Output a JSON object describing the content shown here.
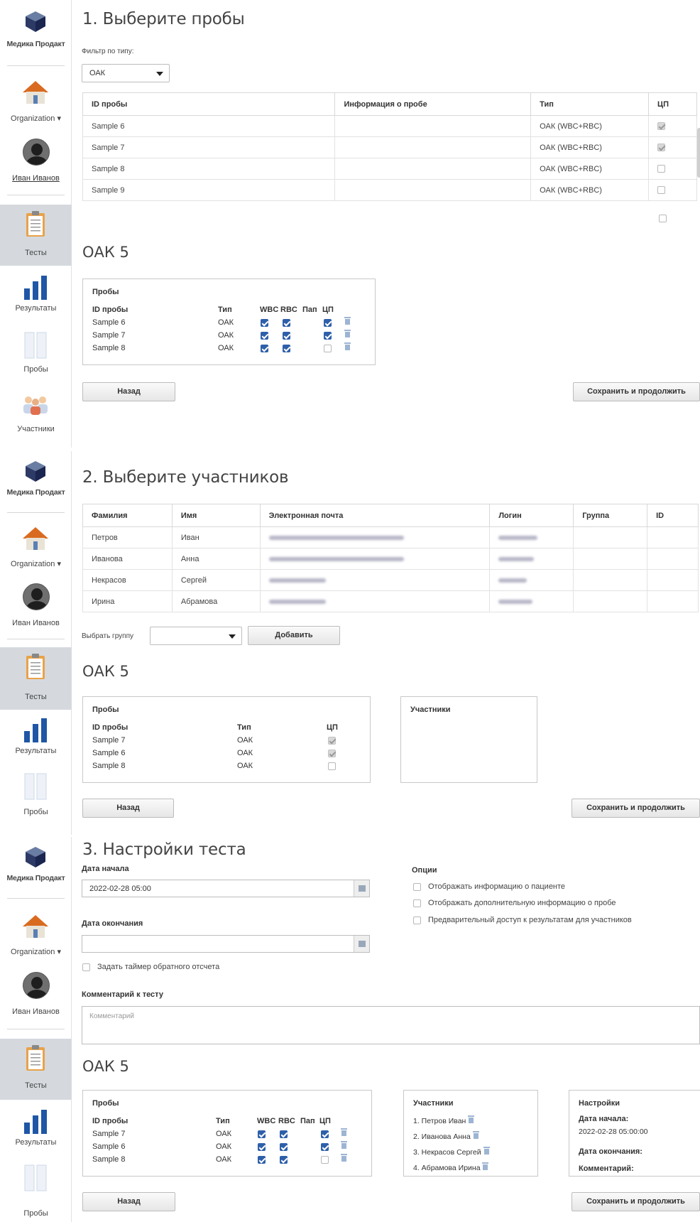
{
  "sidebar": {
    "brand": "Медика Продакт",
    "organization": "Organization",
    "user": "Иван Иванов",
    "items": {
      "tests": "Тесты",
      "results": "Результаты",
      "samples": "Пробы",
      "participants": "Участники"
    }
  },
  "step1": {
    "title": "1. Выберите пробы",
    "filter_label": "Фильтр по типу:",
    "filter_value": "ОАК",
    "columns": [
      "ID пробы",
      "Информация о пробе",
      "Тип",
      "ЦП"
    ],
    "rows": [
      {
        "id": "Sample 6",
        "info": "",
        "type": "ОАК (WBC+RBC)",
        "cp": true
      },
      {
        "id": "Sample 7",
        "info": "",
        "type": "ОАК (WBC+RBC)",
        "cp": true
      },
      {
        "id": "Sample 8",
        "info": "",
        "type": "ОАК (WBC+RBC)",
        "cp": false
      },
      {
        "id": "Sample 9",
        "info": "",
        "type": "ОАК (WBC+RBC)",
        "cp": false
      }
    ],
    "test_name": "ОАК 5",
    "box_title": "Пробы",
    "mini_columns": [
      "ID пробы",
      "Тип",
      "WBC",
      "RBC",
      "Пап",
      "ЦП"
    ],
    "mini_rows": [
      {
        "id": "Sample 6",
        "type": "ОАК",
        "wbc": true,
        "rbc": true,
        "cp": true
      },
      {
        "id": "Sample 7",
        "type": "ОАК",
        "wbc": true,
        "rbc": true,
        "cp": true
      },
      {
        "id": "Sample 8",
        "type": "ОАК",
        "wbc": true,
        "rbc": true,
        "cp": false
      }
    ],
    "back": "Назад",
    "save": "Сохранить и продолжить"
  },
  "step2": {
    "title": "2. Выберите участников",
    "columns": [
      "Фамилия",
      "Имя",
      "Электронная почта",
      "Логин",
      "Группа",
      "ID"
    ],
    "rows": [
      {
        "last": "Петров",
        "first": "Иван"
      },
      {
        "last": "Иванова",
        "first": "Анна"
      },
      {
        "last": "Некрасов",
        "first": "Сергей"
      },
      {
        "last": "Ирина",
        "first": "Абрамова"
      }
    ],
    "group_label": "Выбрать группу",
    "add": "Добавить",
    "test_name": "ОАК 5",
    "box_title": "Пробы",
    "mini_columns": [
      "ID пробы",
      "Тип",
      "ЦП"
    ],
    "mini_rows": [
      {
        "id": "Sample 7",
        "type": "ОАК",
        "cp": true
      },
      {
        "id": "Sample 6",
        "type": "ОАК",
        "cp": true
      },
      {
        "id": "Sample 8",
        "type": "ОАК",
        "cp": false
      }
    ],
    "participants_title": "Участники",
    "back": "Назад",
    "save": "Сохранить и продолжить"
  },
  "step3": {
    "title": "3. Настройки теста",
    "start_label": "Дата начала",
    "start_value": "2022-02-28 05:00",
    "end_label": "Дата окончания",
    "timer": "Задать таймер обратного отсчета",
    "options_title": "Опции",
    "options": [
      "Отображать информацию о пациенте",
      "Отображать дополнительную информацию о пробе",
      "Предварительный доступ к результатам для участников"
    ],
    "comment_label": "Комментарий к тесту",
    "comment_placeholder": "Комментарий",
    "test_name": "ОАК 5",
    "box_title": "Пробы",
    "mini_columns": [
      "ID пробы",
      "Тип",
      "WBC",
      "RBC",
      "Пап",
      "ЦП"
    ],
    "mini_rows": [
      {
        "id": "Sample 7",
        "type": "ОАК",
        "wbc": true,
        "rbc": true,
        "cp": true
      },
      {
        "id": "Sample 6",
        "type": "ОАК",
        "wbc": true,
        "rbc": true,
        "cp": true
      },
      {
        "id": "Sample 8",
        "type": "ОАК",
        "wbc": true,
        "rbc": true,
        "cp": false
      }
    ],
    "participants_title": "Участники",
    "participants": [
      "1. Петров Иван",
      "2. Иванова Анна",
      "3. Некрасов Сергей",
      "4. Абрамова Ирина"
    ],
    "settings_title": "Настройки",
    "settings_start_label": "Дата начала:",
    "settings_start_value": "2022-02-28 05:00:00",
    "settings_end_label": "Дата окончания:",
    "settings_comment_label": "Комментарий:",
    "back": "Назад",
    "save": "Сохранить и продолжить"
  }
}
